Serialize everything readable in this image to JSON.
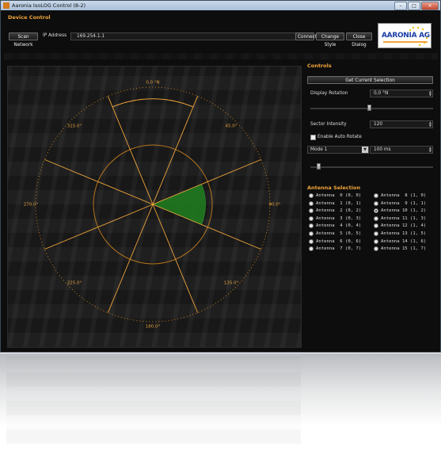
{
  "window": {
    "title": "Aaronia IsoLOG Control (8-2)"
  },
  "device_control": {
    "section_title": "Device Control",
    "scan_button": "Scan Network",
    "ip_label": "IP Address",
    "ip_value": "169.254.1.1",
    "connect_button": "Connect",
    "change_style_button": "Change Style",
    "close_dialog_button": "Close Dialog"
  },
  "logo": {
    "text": "AARONIA AG"
  },
  "polar_plot": {
    "angle_labels": [
      "0.0 °N",
      "45.0°",
      "90.0°",
      "135.0°",
      "180.0°",
      "225.0°",
      "270.0°",
      "315.0°"
    ],
    "sector_count": 8,
    "highlighted_sector_start_deg": 67.5,
    "highlighted_sector_end_deg": 112.5,
    "highlight_level": 0.45,
    "colors": {
      "ring": "#d98a1f",
      "spoke": "#f0a53a",
      "sector": "#1f7a1f"
    }
  },
  "controls": {
    "section_title": "Controls",
    "get_selection_button": "Get Current Selection",
    "display_rotation_label": "Display Rotation",
    "display_rotation_value": "0,0 °N",
    "display_rotation_slider": 0.48,
    "sector_intensity_label": "Sector Intensity",
    "sector_intensity_value": "120",
    "sector_intensity_slider": 0.05,
    "auto_rotate_label": "Enable Auto Rotate",
    "auto_rotate_checked": false,
    "mode_value": "Mode 1",
    "interval_value": "100 ms",
    "auto_rotate_slider": 0.05
  },
  "antenna_selection": {
    "section_title": "Antenna Selection",
    "left": [
      {
        "text": "Antenna  0 (0, 0)",
        "checked": false
      },
      {
        "text": "Antenna  1 (0, 1)",
        "checked": false
      },
      {
        "text": "Antenna  2 (0, 2)",
        "checked": false
      },
      {
        "text": "Antenna  3 (0, 3)",
        "checked": false
      },
      {
        "text": "Antenna  4 (0, 4)",
        "checked": false
      },
      {
        "text": "Antenna  5 (0, 5)",
        "checked": false
      },
      {
        "text": "Antenna  6 (0, 6)",
        "checked": false
      },
      {
        "text": "Antenna  7 (0, 7)",
        "checked": false
      }
    ],
    "right": [
      {
        "text": "Antenna  8 (1, 0)",
        "checked": false
      },
      {
        "text": "Antenna  9 (1, 1)",
        "checked": false
      },
      {
        "text": "Antenna 10 (1, 2)",
        "checked": true
      },
      {
        "text": "Antenna 11 (1, 3)",
        "checked": false
      },
      {
        "text": "Antenna 12 (1, 4)",
        "checked": false
      },
      {
        "text": "Antenna 13 (1, 5)",
        "checked": false
      },
      {
        "text": "Antenna 14 (1, 6)",
        "checked": false
      },
      {
        "text": "Antenna 15 (1, 7)",
        "checked": false
      }
    ]
  }
}
